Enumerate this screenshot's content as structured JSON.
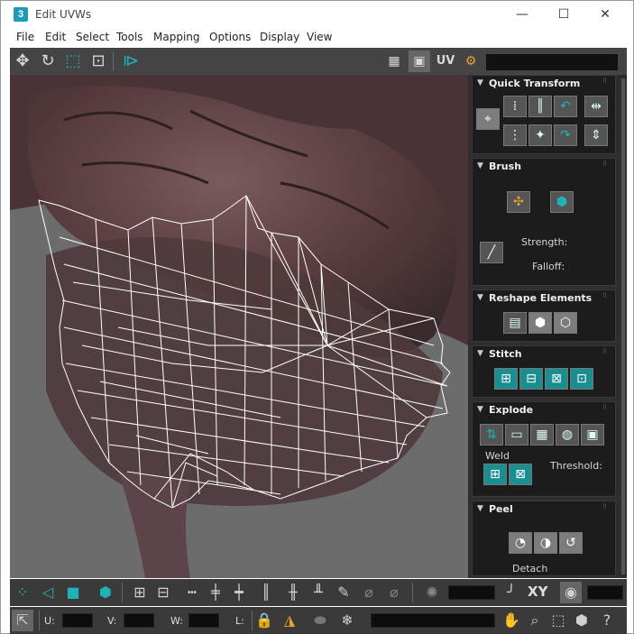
{
  "window": {
    "title": "Edit UVWs",
    "app_icon_label": "3",
    "minimize_glyph": "—",
    "maximize_glyph": "☐",
    "close_glyph": "✕"
  },
  "menu": {
    "items": [
      "File",
      "Edit",
      "Select",
      "Tools",
      "Mapping",
      "Options",
      "Display",
      "View"
    ]
  },
  "top_toolbar": {
    "left_tools": [
      "move-icon",
      "rotate-icon",
      "scale-icon",
      "freeform-icon",
      "mirror-icon"
    ],
    "uv_label": "UV",
    "right_tools": [
      "checker-pattern-icon",
      "show-map-icon",
      "uv-label-icon",
      "options-gear-icon"
    ]
  },
  "panels": {
    "quick_transform": {
      "title": "Quick Transform"
    },
    "brush": {
      "title": "Brush",
      "strength_label": "Strength:",
      "falloff_label": "Falloff:"
    },
    "reshape": {
      "title": "Reshape Elements"
    },
    "stitch": {
      "title": "Stitch"
    },
    "explode": {
      "title": "Explode",
      "weld_label": "Weld",
      "threshold_label": "Threshold:"
    },
    "peel": {
      "title": "Peel",
      "detach_label": "Detach"
    }
  },
  "bottom_toolbar": {
    "xy_label": "XY",
    "u_label": "U:",
    "v_label": "V:",
    "w_label": "W:",
    "l_label": "L:"
  },
  "colors": {
    "accent_teal": "#1b8e91",
    "panel_dark": "#1c1c1c",
    "toolbar": "#444444",
    "viewport_bg": "#6a6a6a"
  }
}
